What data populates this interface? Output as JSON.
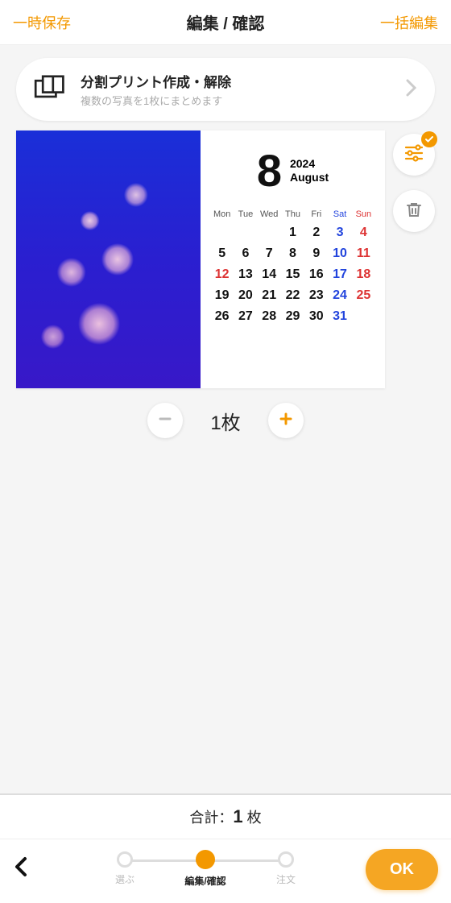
{
  "header": {
    "left": "一時保存",
    "title": "編集 / 確認",
    "right": "一括編集"
  },
  "banner": {
    "title": "分割プリント作成・解除",
    "sub": "複数の写真を1枚にまとめます"
  },
  "calendar": {
    "month": "8",
    "year": "2024",
    "monthName": "August",
    "dow": [
      {
        "t": "Mon",
        "c": ""
      },
      {
        "t": "Tue",
        "c": ""
      },
      {
        "t": "Wed",
        "c": ""
      },
      {
        "t": "Thu",
        "c": ""
      },
      {
        "t": "Fri",
        "c": ""
      },
      {
        "t": "Sat",
        "c": "sat"
      },
      {
        "t": "Sun",
        "c": "sun"
      }
    ],
    "cells": [
      {
        "t": "0",
        "c": "empty"
      },
      {
        "t": "0",
        "c": "empty"
      },
      {
        "t": "0",
        "c": "empty"
      },
      {
        "t": "1",
        "c": ""
      },
      {
        "t": "2",
        "c": ""
      },
      {
        "t": "3",
        "c": "sat"
      },
      {
        "t": "4",
        "c": "sun"
      },
      {
        "t": "5",
        "c": ""
      },
      {
        "t": "6",
        "c": ""
      },
      {
        "t": "7",
        "c": ""
      },
      {
        "t": "8",
        "c": ""
      },
      {
        "t": "9",
        "c": ""
      },
      {
        "t": "10",
        "c": "sat"
      },
      {
        "t": "11",
        "c": "sun"
      },
      {
        "t": "12",
        "c": "hol"
      },
      {
        "t": "13",
        "c": ""
      },
      {
        "t": "14",
        "c": ""
      },
      {
        "t": "15",
        "c": ""
      },
      {
        "t": "16",
        "c": ""
      },
      {
        "t": "17",
        "c": "sat"
      },
      {
        "t": "18",
        "c": "sun"
      },
      {
        "t": "19",
        "c": ""
      },
      {
        "t": "20",
        "c": ""
      },
      {
        "t": "21",
        "c": ""
      },
      {
        "t": "22",
        "c": ""
      },
      {
        "t": "23",
        "c": ""
      },
      {
        "t": "24",
        "c": "sat"
      },
      {
        "t": "25",
        "c": "sun"
      },
      {
        "t": "26",
        "c": ""
      },
      {
        "t": "27",
        "c": ""
      },
      {
        "t": "28",
        "c": ""
      },
      {
        "t": "29",
        "c": ""
      },
      {
        "t": "30",
        "c": ""
      },
      {
        "t": "31",
        "c": "sat"
      },
      {
        "t": "0",
        "c": "empty"
      }
    ]
  },
  "qty": {
    "value": "1枚"
  },
  "footer": {
    "totalLabel": "合計：",
    "totalValue": "1",
    "totalUnit": "枚",
    "steps": [
      {
        "label": "選ぶ",
        "active": false
      },
      {
        "label": "編集/確認",
        "active": true
      },
      {
        "label": "注文",
        "active": false
      }
    ],
    "ok": "OK"
  },
  "colors": {
    "accent": "#f39800"
  }
}
